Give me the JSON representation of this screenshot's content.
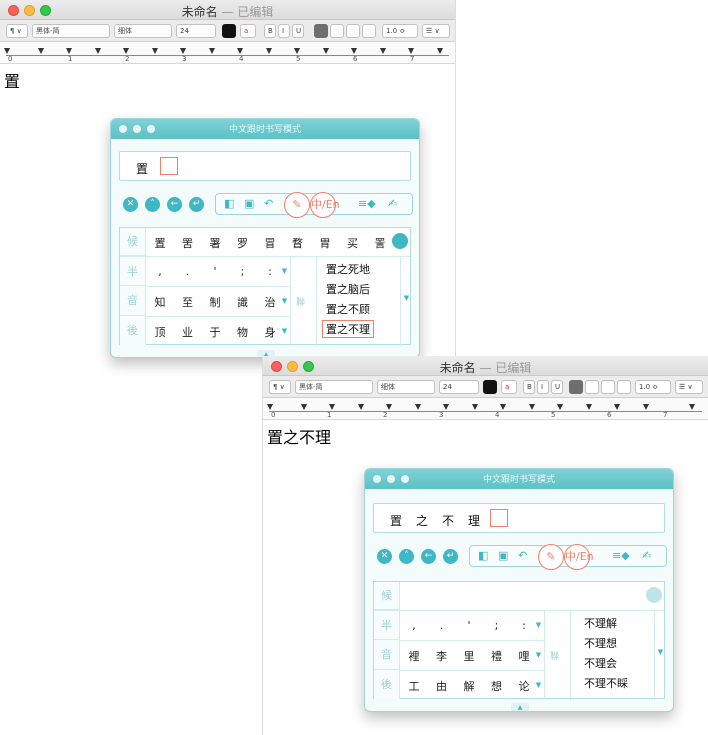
{
  "window_top": {
    "title": "未命名",
    "subtitle": "— 已编辑",
    "doc_text": "置",
    "toolbar": {
      "paragraph": "¶ ∨",
      "font_family": "黑体-简",
      "font_style": "细体",
      "font_size": "24",
      "bold": "B",
      "italic": "I",
      "underline": "U",
      "spacing": "1.0 ≎",
      "list": "☰ ∨"
    },
    "ruler": [
      "0",
      "1",
      "2",
      "3",
      "4",
      "5",
      "6",
      "7"
    ]
  },
  "window_bottom": {
    "title": "未命名",
    "subtitle": "— 已编辑",
    "doc_text": "置之不理",
    "toolbar": {
      "paragraph": "¶ ∨",
      "font_family": "黑体-简",
      "font_style": "细体",
      "font_size": "24",
      "bold": "B",
      "italic": "I",
      "underline": "U",
      "spacing": "1.0 ≎",
      "list": "☰ ∨"
    },
    "ruler": [
      "0",
      "1",
      "2",
      "3",
      "4",
      "5",
      "6",
      "7"
    ]
  },
  "ime_top": {
    "title": "中文跟时书写模式",
    "input_chars": [
      "置"
    ],
    "labels": {
      "hou": "候",
      "ban": "半",
      "yin": "音",
      "hou2": "後",
      "lian": "聯"
    },
    "pen_mode": "中/En",
    "candidates": [
      "置",
      "罟",
      "署",
      "罗",
      "冒",
      "瞀",
      "胃",
      "买",
      "詈"
    ],
    "punct": [
      ",",
      ".",
      "'",
      ";",
      ":"
    ],
    "row_yin": [
      "知",
      "至",
      "制",
      "識",
      "治"
    ],
    "row_hou": [
      "顶",
      "业",
      "于",
      "物",
      "身"
    ],
    "assoc": [
      "置之死地",
      "置之脑后",
      "置之不顾",
      "置之不理"
    ]
  },
  "ime_bottom": {
    "title": "中文跟时书写模式",
    "input_chars": [
      "置",
      "之",
      "不",
      "理"
    ],
    "labels": {
      "hou": "候",
      "ban": "半",
      "yin": "音",
      "hou2": "後",
      "lian": "聯"
    },
    "pen_mode": "中/En",
    "candidates": [],
    "punct": [
      ",",
      ".",
      "'",
      ";",
      ":"
    ],
    "row_yin": [
      "裡",
      "李",
      "里",
      "禮",
      "哩"
    ],
    "row_hou": [
      "工",
      "由",
      "解",
      "想",
      "论"
    ],
    "assoc": [
      "不理解",
      "不理想",
      "不理会",
      "不理不睬"
    ]
  },
  "colors": {
    "teal": "#40b7c4",
    "title_teal": "#5cc1c6",
    "accent_red": "#f0806b"
  }
}
